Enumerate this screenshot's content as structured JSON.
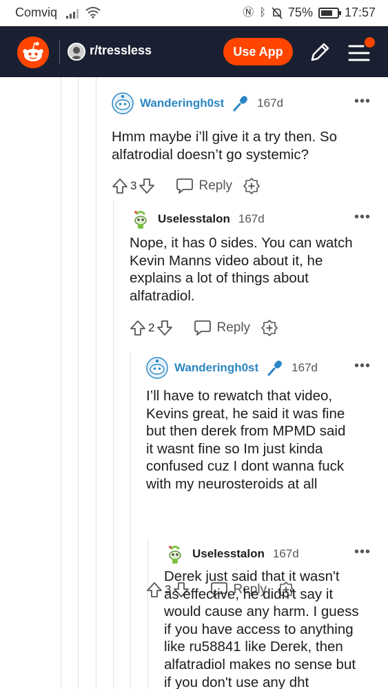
{
  "status_bar": {
    "carrier": "Comviq",
    "battery": "75%",
    "time": "17:57"
  },
  "header": {
    "subreddit": "r/tressless",
    "use_app_label": "Use App"
  },
  "colors": {
    "reddit_orange": "#ff4500",
    "header_bg": "#1a2031",
    "flair_blue": "#2b86c5"
  },
  "comments": [
    {
      "author": "Wanderingh0st",
      "age": "167d",
      "body": [
        "Hmm maybe i’ll give it a try then. So",
        "alfatrodial doesn’t go systemic?"
      ],
      "score": "3",
      "reply_label": "Reply"
    },
    {
      "author": "Uselesstalon",
      "age": "167d",
      "body": [
        "Nope, it has 0 sides. You can watch",
        "Kevin Manns video about it, he",
        "explains a lot of things about",
        "alfatradiol."
      ],
      "score": "2",
      "reply_label": "Reply"
    },
    {
      "author": "Wanderingh0st",
      "age": "167d",
      "body": [
        "I’ll have to rewatch that video,",
        "Kevins great, he said it was fine",
        "but then derek from MPMD said",
        "it wasnt fine so Im just kinda",
        "confused cuz I dont wanna fuck",
        "with my neurosteroids at all"
      ],
      "score": "3",
      "reply_label": "Reply"
    },
    {
      "author": "Uselesstalon",
      "age": "167d",
      "body": [
        "Derek just said that it wasn't",
        "as effective, he didn't say it",
        "would cause any harm. I guess",
        "if you have access to anything",
        "like ru58841 like Derek, then",
        "alfatradiol makes no sense but",
        "if you don't use any dht"
      ]
    }
  ]
}
